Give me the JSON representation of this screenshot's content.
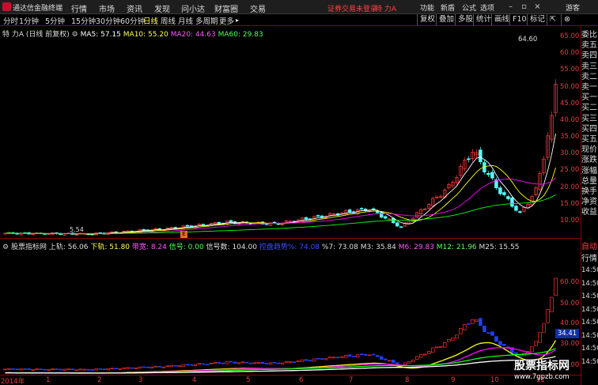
{
  "menubar": {
    "app_title": "通达信金融终端",
    "items": [
      "行情",
      "市场",
      "资讯",
      "发现",
      "问小达",
      "财富圈",
      "交易"
    ],
    "alert": "证券交易未登录",
    "stock_short": "特 力A",
    "right_items": [
      "功能",
      "新盾",
      "公式",
      "选项"
    ],
    "guest": "游客"
  },
  "periodbar": {
    "periods": [
      "分时",
      "1分钟",
      "5分钟",
      "15分钟",
      "30分钟",
      "60分钟",
      "日线",
      "周线",
      "月线",
      "多周期",
      "更多"
    ],
    "active": "日线",
    "buttons": [
      "复权",
      "叠加",
      "多股",
      "统计",
      "画线",
      "F10",
      "标记"
    ]
  },
  "main_info": {
    "title": "特 力A (日线 前复权)",
    "ma5": "MA5: 57.15",
    "ma10": "MA10: 55.20",
    "ma20": "MA20: 44.63",
    "ma60": "MA60: 29.83"
  },
  "indicator_info": {
    "name": "股票指标网",
    "upper": "上轨: 56.06",
    "lower": "下轨: 51.80",
    "width": "带宽: 8.24",
    "signal": "信号: 0.00",
    "signal_count": "信号数: 104.00",
    "blue_label": "控盘趋势%: 74.08",
    "m3": "M3: 35.84",
    "m6": "M6: 29.83",
    "m12": "M12: 21.96",
    "m25": "M25: 15.55",
    "pct7": "%7: 73.08"
  },
  "main_chart": {
    "peak_label": "64.60",
    "low_label": "5.54",
    "y_ticks": [
      "65.00",
      "60.00",
      "55.00",
      "50.00",
      "45.00",
      "40.00",
      "35.00",
      "30.00",
      "25.00",
      "20.00",
      "15.00",
      "10.00"
    ]
  },
  "ind_chart": {
    "price_tag": "34.41",
    "y_ticks": [
      "60.00",
      "50.00",
      "40.00",
      "30.00",
      "20.00"
    ]
  },
  "x_axis": {
    "labels": [
      "2014年",
      "1",
      "2",
      "3",
      "4",
      "5",
      "6",
      "7",
      "8",
      "9",
      "10",
      "11"
    ]
  },
  "right_panel": {
    "items": [
      "委比",
      "卖五",
      "卖四",
      "卖三",
      "卖二",
      "卖一",
      "买一",
      "买二",
      "买三",
      "买四",
      "买五",
      "现价",
      "涨跌",
      "涨幅",
      "总量",
      "换手",
      "净资",
      "收益"
    ],
    "bottom_items": [
      "自动",
      "行情"
    ],
    "times": [
      "14:50",
      "14:50",
      "14:50",
      "14:50",
      "14:50",
      "14:50",
      "14:50",
      "14:50"
    ]
  },
  "watermark": {
    "name": "股票指标网",
    "url": "www.7gpzb.com"
  },
  "colors": {
    "up": "#ff3c3c",
    "down": "#54ffff",
    "ma5": "#ffffff",
    "ma10": "#ffff00",
    "ma20": "#ff00ff",
    "ma60": "#00ff00"
  }
}
